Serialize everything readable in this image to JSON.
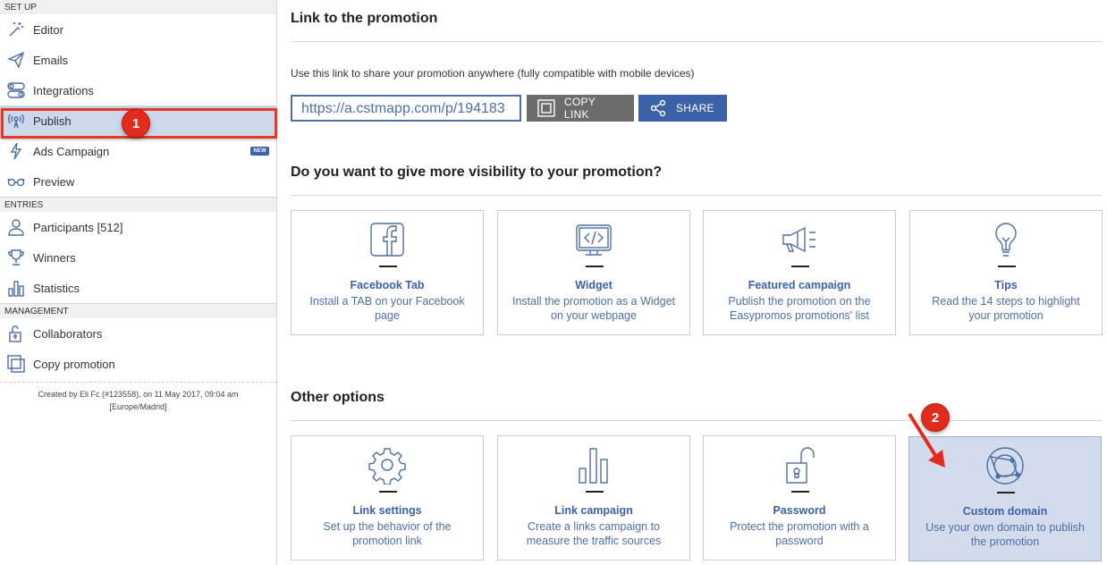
{
  "sidebar": {
    "setup_header": "SET UP",
    "setup_items": [
      {
        "label": "Editor",
        "icon": "magic-wand-icon"
      },
      {
        "label": "Emails",
        "icon": "paper-plane-icon"
      },
      {
        "label": "Integrations",
        "icon": "toggles-icon"
      },
      {
        "label": "Publish",
        "icon": "broadcast-icon"
      },
      {
        "label": "Ads Campaign",
        "icon": "lightning-icon",
        "badge": "NEW"
      },
      {
        "label": "Preview",
        "icon": "glasses-icon"
      }
    ],
    "entries_header": "ENTRIES",
    "entries_items": [
      {
        "label": "Participants [512]",
        "icon": "user-icon"
      },
      {
        "label": "Winners",
        "icon": "trophy-icon"
      },
      {
        "label": "Statistics",
        "icon": "bar-chart-icon"
      }
    ],
    "management_header": "MANAGEMENT",
    "management_items": [
      {
        "label": "Collaborators",
        "icon": "lock-icon"
      },
      {
        "label": "Copy promotion",
        "icon": "copy-icon"
      }
    ],
    "footer_line1": "Created by Eli Fc (#123558), on 11 May 2017, 09:04 am",
    "footer_line2": "[Europe/Madrid]"
  },
  "main": {
    "link_title": "Link to the promotion",
    "link_hint": "Use this link to share your promotion anywhere (fully compatible with mobile devices)",
    "link_url": "https://a.cstmapp.com/p/194183",
    "copy_label": "COPY LINK",
    "share_label": "SHARE",
    "visibility_title": "Do you want to give more visibility to your promotion?",
    "visibility_cards": [
      {
        "title": "Facebook Tab",
        "desc": "Install a TAB on your Facebook page",
        "icon": "facebook-icon"
      },
      {
        "title": "Widget",
        "desc": "Install the promotion as a Widget on your webpage",
        "icon": "code-window-icon"
      },
      {
        "title": "Featured campaign",
        "desc": "Publish the promotion on the Easypromos promotions' list",
        "icon": "megaphone-icon"
      },
      {
        "title": "Tips",
        "desc": "Read the 14 steps to highlight your promotion",
        "icon": "lightbulb-icon"
      }
    ],
    "other_title": "Other options",
    "other_cards": [
      {
        "title": "Link settings",
        "desc": "Set up the behavior of the promotion link",
        "icon": "gear-icon"
      },
      {
        "title": "Link campaign",
        "desc": "Create a links campaign to measure the traffic sources",
        "icon": "bar-chart-icon"
      },
      {
        "title": "Password",
        "desc": "Protect the promotion with a password",
        "icon": "padlock-icon"
      },
      {
        "title": "Custom domain",
        "desc": "Use your own domain to publish the promotion",
        "icon": "globe-icon"
      }
    ]
  },
  "annotations": {
    "marker1": "1",
    "marker2": "2",
    "accent": "#e22b1d"
  },
  "colors": {
    "brand": "#3b62a8",
    "active_bg": "#cdd8eb",
    "copy_btn": "#6c6c6c"
  }
}
